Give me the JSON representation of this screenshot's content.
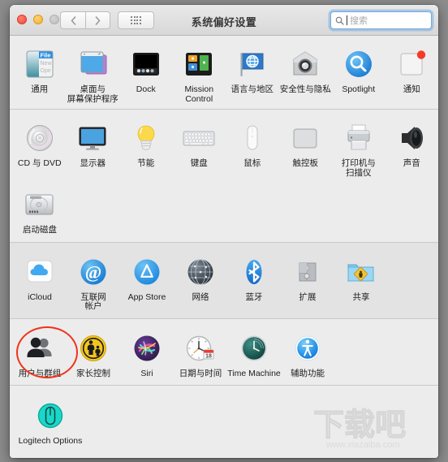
{
  "window": {
    "title": "系统偏好设置",
    "traffic_lights": [
      "close",
      "minimize",
      "zoom"
    ],
    "nav": {
      "back_icon": "chevron-left-icon",
      "forward_icon": "chevron-right-icon"
    },
    "grid_button_icon": "grid-view-icon"
  },
  "search": {
    "placeholder": "搜索",
    "value": "",
    "icon": "search-icon"
  },
  "annotation": {
    "type": "ellipse",
    "color": "#f0331a",
    "targets": "用户与群组"
  },
  "watermark": {
    "text": "下载吧",
    "url": "www.xiazaiba.com"
  },
  "sections": [
    {
      "id": "personal",
      "rows": [
        [
          {
            "label": "通用",
            "icon": "general-icon"
          },
          {
            "label": "桌面与\n屏幕保护程序",
            "icon": "desktop-screensaver-icon"
          },
          {
            "label": "Dock",
            "icon": "dock-icon"
          },
          {
            "label": "Mission\nControl",
            "icon": "mission-control-icon"
          },
          {
            "label": "语言与地区",
            "icon": "language-region-icon"
          },
          {
            "label": "安全性与隐私",
            "icon": "security-privacy-icon"
          },
          {
            "label": "Spotlight",
            "icon": "spotlight-icon"
          },
          {
            "label": "通知",
            "icon": "notifications-icon"
          }
        ]
      ]
    },
    {
      "id": "hardware",
      "rows": [
        [
          {
            "label": "CD 与 DVD",
            "icon": "cd-dvd-icon"
          },
          {
            "label": "显示器",
            "icon": "displays-icon"
          },
          {
            "label": "节能",
            "icon": "energy-saver-icon"
          },
          {
            "label": "键盘",
            "icon": "keyboard-icon"
          },
          {
            "label": "鼠标",
            "icon": "mouse-icon"
          },
          {
            "label": "触控板",
            "icon": "trackpad-icon"
          },
          {
            "label": "打印机与\n扫描仪",
            "icon": "printers-scanners-icon"
          },
          {
            "label": "声音",
            "icon": "sound-icon"
          }
        ],
        [
          {
            "label": "启动磁盘",
            "icon": "startup-disk-icon"
          }
        ]
      ]
    },
    {
      "id": "internet",
      "rows": [
        [
          {
            "label": "iCloud",
            "icon": "icloud-icon"
          },
          {
            "label": "互联网\n帐户",
            "icon": "internet-accounts-icon"
          },
          {
            "label": "App Store",
            "icon": "app-store-icon"
          },
          {
            "label": "网络",
            "icon": "network-icon"
          },
          {
            "label": "蓝牙",
            "icon": "bluetooth-icon"
          },
          {
            "label": "扩展",
            "icon": "extensions-icon"
          },
          {
            "label": "共享",
            "icon": "sharing-icon"
          }
        ]
      ]
    },
    {
      "id": "system",
      "rows": [
        [
          {
            "label": "用户与群组",
            "icon": "users-groups-icon",
            "annotated": true
          },
          {
            "label": "家长控制",
            "icon": "parental-controls-icon"
          },
          {
            "label": "Siri",
            "icon": "siri-icon"
          },
          {
            "label": "日期与时间",
            "icon": "date-time-icon"
          },
          {
            "label": "Time Machine",
            "icon": "time-machine-icon"
          },
          {
            "label": "辅助功能",
            "icon": "accessibility-icon"
          }
        ]
      ]
    },
    {
      "id": "other",
      "rows": [
        [
          {
            "label": "Logitech Options",
            "icon": "logitech-options-icon"
          }
        ]
      ]
    }
  ]
}
